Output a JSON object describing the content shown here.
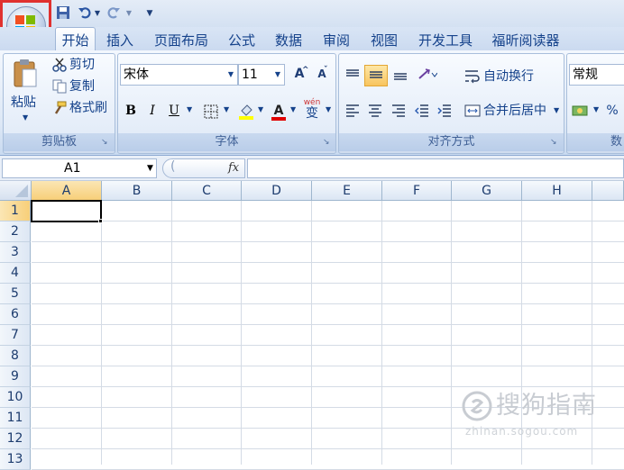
{
  "quick_access": {
    "save_icon": "save-icon",
    "undo_icon": "undo-icon",
    "redo_icon": "redo-icon",
    "customize_symbol": "▼"
  },
  "tabs": [
    "开始",
    "插入",
    "页面布局",
    "公式",
    "数据",
    "审阅",
    "视图",
    "开发工具",
    "福昕阅读器"
  ],
  "clipboard": {
    "paste": "粘贴",
    "cut": "剪切",
    "copy": "复制",
    "format_painter": "格式刷",
    "label": "剪贴板"
  },
  "font": {
    "name": "宋体",
    "size": "11",
    "bold": "B",
    "italic": "I",
    "underline": "U",
    "wen": "wén",
    "wen_char": "变",
    "label": "字体",
    "grow": "A",
    "shrink": "A"
  },
  "alignment": {
    "wrap": "自动换行",
    "merge": "合并后居中",
    "label": "对齐方式"
  },
  "number": {
    "format": "常规",
    "percent": "%",
    "label": "数"
  },
  "formula": {
    "name_box": "A1",
    "fx": "fx",
    "value": ""
  },
  "columns": [
    "A",
    "B",
    "C",
    "D",
    "E",
    "F",
    "G",
    "H"
  ],
  "rows": [
    "1",
    "2",
    "3",
    "4",
    "5",
    "6",
    "7",
    "8",
    "9",
    "10",
    "11",
    "12",
    "13"
  ],
  "watermark": {
    "text": "搜狗指南",
    "url": "zhinan.sogou.com"
  },
  "colors": {
    "accent": "#e0312f",
    "ribbon": "#dde8f6",
    "selection": "#f7cf79"
  }
}
